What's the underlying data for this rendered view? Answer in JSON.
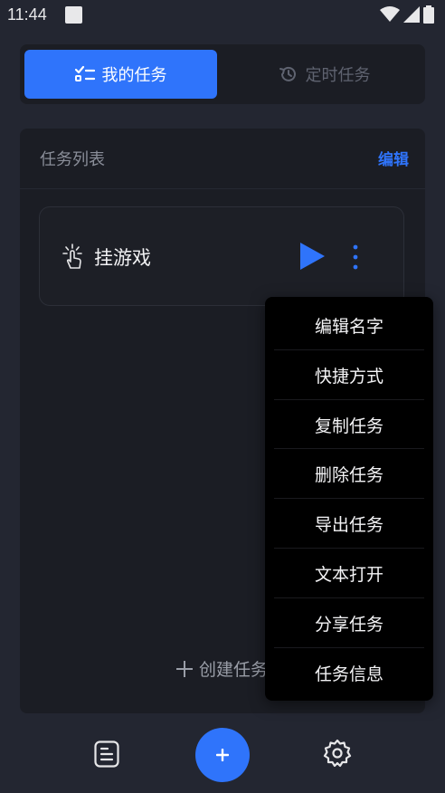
{
  "status_bar": {
    "time": "11:44"
  },
  "tabs": [
    {
      "label": "我的任务",
      "icon": "checklist-icon",
      "active": true
    },
    {
      "label": "定时任务",
      "icon": "clock-history-icon",
      "active": false
    }
  ],
  "panel": {
    "title": "任务列表",
    "edit_label": "编辑"
  },
  "tasks": [
    {
      "name": "挂游戏",
      "icon": "tap-hand-icon"
    }
  ],
  "create_task_label": "创建任务",
  "menu": {
    "items": [
      "编辑名字",
      "快捷方式",
      "复制任务",
      "删除任务",
      "导出任务",
      "文本打开",
      "分享任务",
      "任务信息"
    ]
  },
  "colors": {
    "accent": "#2f74fb",
    "background": "#232631",
    "panel": "#1b1d24",
    "menu": "#000000"
  }
}
